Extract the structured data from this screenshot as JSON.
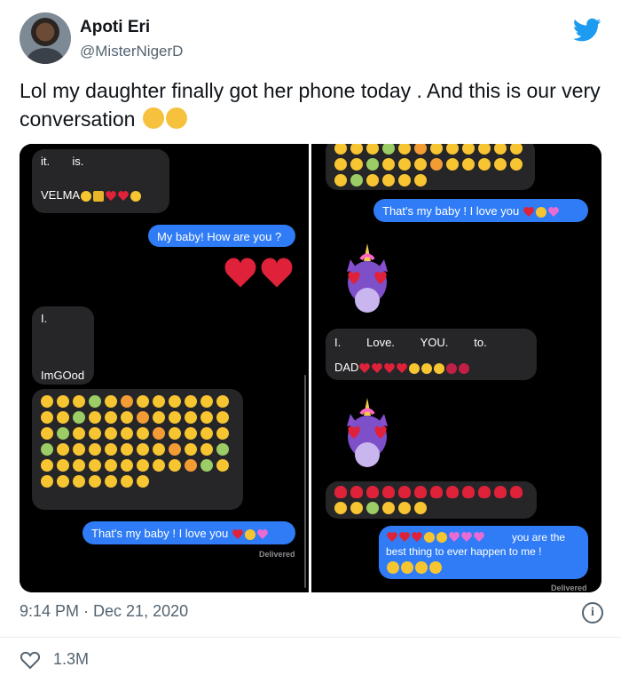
{
  "author": {
    "name": "Apoti Eri",
    "handle": "@MisterNigerD"
  },
  "tweet": {
    "text": "Lol my daughter finally got her phone today . And this is our very conversation",
    "emoji_trailing": [
      "face-with-tears-of-joy",
      "face-with-tears-of-joy"
    ]
  },
  "left_chat": {
    "msg1_line1": "it.       is.",
    "msg1_line2": "VELMA",
    "msg2": "My baby! How are you ?",
    "msg3_line1": "I.",
    "msg3_line2": "ImGOod",
    "msg5": "That's my baby ! I love you",
    "delivered": "Delivered"
  },
  "right_chat": {
    "msg1": "That's my baby ! I love you",
    "msg2_line1": "I.        Love.        YOU.        to.",
    "msg2_line2": "DAD",
    "msg4_text": "you are the best thing to ever happen to me !",
    "delivered": "Delivered"
  },
  "footer": {
    "time": "9:14 PM · Dec 21, 2020",
    "likes": "1.3M",
    "info_label": "i"
  },
  "colors": {
    "twitter_blue": "#1d9bf0",
    "imessage_blue": "#2f7cf6",
    "received_bubble": "#262628",
    "heart_red": "#e0213a",
    "emoji_yellow": "#f7c531"
  },
  "icons": [
    "twitter-bird-icon",
    "heart-outline-icon",
    "info-icon",
    "unicorn-memoji",
    "red-heart-emoji"
  ]
}
